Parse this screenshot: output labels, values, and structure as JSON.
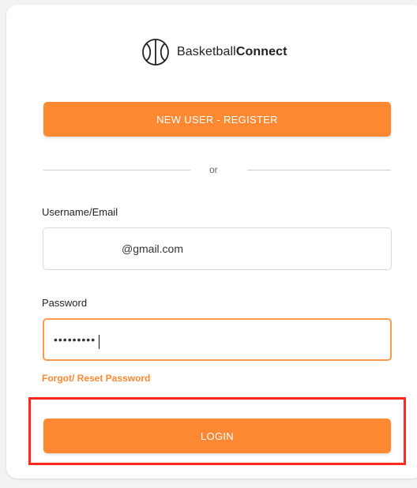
{
  "brand": {
    "name_regular": "Basketball",
    "name_bold": "Connect",
    "icon": "basketball-icon"
  },
  "buttons": {
    "register_label": "NEW USER - REGISTER",
    "login_label": "LOGIN"
  },
  "divider": {
    "text": "or"
  },
  "form": {
    "username_label": "Username/Email",
    "username_value": "@gmail.com",
    "password_label": "Password",
    "password_value": "•••••••••",
    "forgot_link": "Forgot/ Reset Password"
  },
  "colors": {
    "accent": "#ff8833",
    "highlight": "#ff2a1a"
  }
}
